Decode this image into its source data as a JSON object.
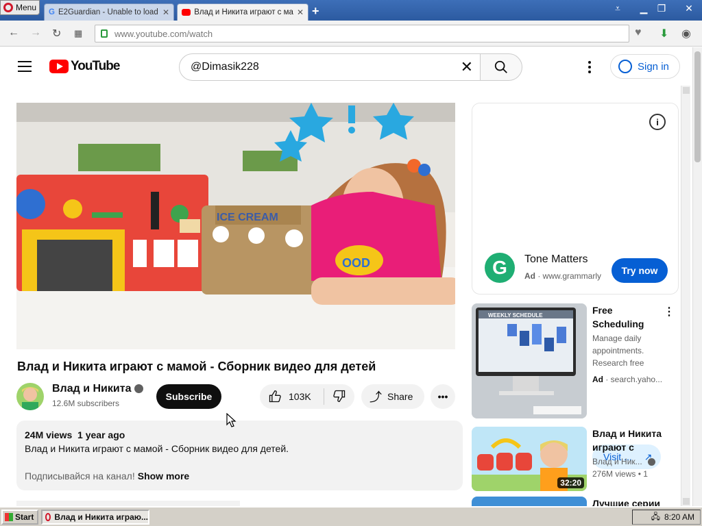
{
  "browser": {
    "menu_label": "Menu",
    "tabs": [
      {
        "label": "E2Guardian - Unable to load"
      },
      {
        "label": "Влад и Никита играют с ма"
      }
    ],
    "url": "www.youtube.com/watch"
  },
  "youtube": {
    "logo_text": "YouTube",
    "search_value": "@Dimasik228",
    "signin_label": "Sign in"
  },
  "video": {
    "title": "Влад и Никита играют с мамой - Сборник видео для детей",
    "channel": "Влад и Никита",
    "subscribers": "12.6M subscribers",
    "subscribe_label": "Subscribe",
    "likes": "103K",
    "share_label": "Share",
    "views": "24M views",
    "age": "1 year ago",
    "description_line1": "Влад и Никита играют с мамой - Сборник видео для детей.",
    "description_line2": "Подписывайся на канал!",
    "show_more": "Show more",
    "ice_cream_text": "ICE CREAM",
    "food_text": "OOD"
  },
  "sidebar": {
    "ad_top": {
      "name": "Tone Matters",
      "ad_badge": "Ad",
      "url": "www.grammarly.com",
      "cta": "Try now"
    },
    "ad_card": {
      "title": "Free Scheduling",
      "desc_line1": "Manage daily",
      "desc_line2": "appointments.",
      "desc_line3": "Research free",
      "ad_badge": "Ad",
      "source": "search.yaho...",
      "cta": "Visit ...",
      "thumb_header": "WEEKLY SCHEDULE"
    },
    "rec1": {
      "title": "Влад и Никита играют с",
      "channel": "Влад и Ник...",
      "meta": "276M views • 1",
      "duration": "32:20"
    },
    "rec2": {
      "title": "Лучшие серии"
    }
  },
  "taskbar": {
    "start_label": "Start",
    "task_label": "Влад и Никита играю...",
    "clock": "8:20 AM"
  }
}
